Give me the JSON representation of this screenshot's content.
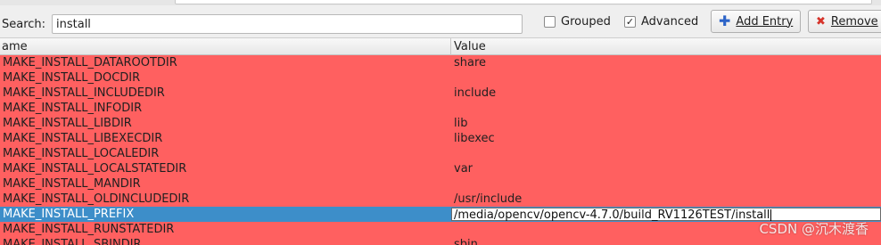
{
  "toolbar": {
    "search_label": "Search:",
    "search_value": "install",
    "grouped_label": "Grouped",
    "grouped_checked": false,
    "advanced_label": "Advanced",
    "advanced_checked": true,
    "add_entry_label": "Add Entry",
    "remove_label": "Remove"
  },
  "table": {
    "columns": [
      "ame",
      "Value"
    ],
    "rows": [
      {
        "name": "MAKE_INSTALL_DATAROOTDIR",
        "value": "share"
      },
      {
        "name": "MAKE_INSTALL_DOCDIR",
        "value": ""
      },
      {
        "name": "MAKE_INSTALL_INCLUDEDIR",
        "value": "include"
      },
      {
        "name": "MAKE_INSTALL_INFODIR",
        "value": ""
      },
      {
        "name": "MAKE_INSTALL_LIBDIR",
        "value": "lib"
      },
      {
        "name": "MAKE_INSTALL_LIBEXECDIR",
        "value": "libexec"
      },
      {
        "name": "MAKE_INSTALL_LOCALEDIR",
        "value": ""
      },
      {
        "name": "MAKE_INSTALL_LOCALSTATEDIR",
        "value": "var"
      },
      {
        "name": "MAKE_INSTALL_MANDIR",
        "value": ""
      },
      {
        "name": "MAKE_INSTALL_OLDINCLUDEDIR",
        "value": "/usr/include"
      },
      {
        "name": "MAKE_INSTALL_PREFIX",
        "value": "/media/opencv/opencv-4.7.0/build_RV1126TEST/install"
      },
      {
        "name": "MAKE_INSTALL_RUNSTATEDIR",
        "value": ""
      },
      {
        "name": "MAKE_INSTALL_SBINDIR",
        "value": "sbin"
      }
    ],
    "selected_index": 10,
    "row_color": "#ff6060",
    "selected_color": "#3d8ec9"
  },
  "watermark": "CSDN @沉木渡香"
}
